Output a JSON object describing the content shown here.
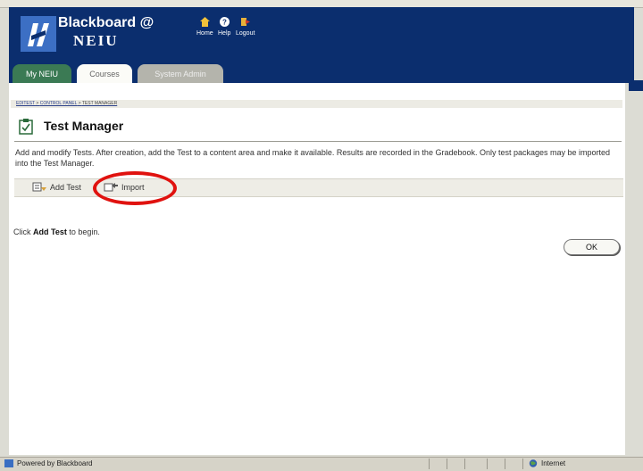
{
  "header": {
    "brand_line1": "Blackboard @",
    "brand_line2": "NEIU",
    "nav": [
      {
        "label": "Home",
        "icon": "home-icon"
      },
      {
        "label": "Help",
        "icon": "help-icon"
      },
      {
        "label": "Logout",
        "icon": "logout-icon"
      }
    ]
  },
  "tabs": [
    {
      "label": "My NEIU",
      "state": "inactive"
    },
    {
      "label": "Courses",
      "state": "active"
    },
    {
      "label": "System Admin",
      "state": "inactive"
    }
  ],
  "breadcrumb": {
    "items": [
      "EDITEST",
      "CONTROL PANEL",
      "TEST MANAGER"
    ],
    "separator": " > "
  },
  "page": {
    "title": "Test Manager",
    "description": "Add and modify Tests. After creation, add the Test to a content area and make it available. Results are recorded in the Gradebook. Only test packages may be imported into the Test Manager."
  },
  "actions": [
    {
      "label": "Add Test",
      "icon": "add-test-icon"
    },
    {
      "label": "Import",
      "icon": "import-icon"
    }
  ],
  "hint": {
    "prefix": "Click ",
    "bold": "Add Test",
    "suffix": " to begin."
  },
  "ok_label": "OK",
  "status": {
    "left": "Powered by Blackboard",
    "zone": "Internet"
  },
  "colors": {
    "header_bg": "#0b2e6e",
    "active_tab_green": "#3b7a54",
    "highlight_red": "#e0120f"
  }
}
